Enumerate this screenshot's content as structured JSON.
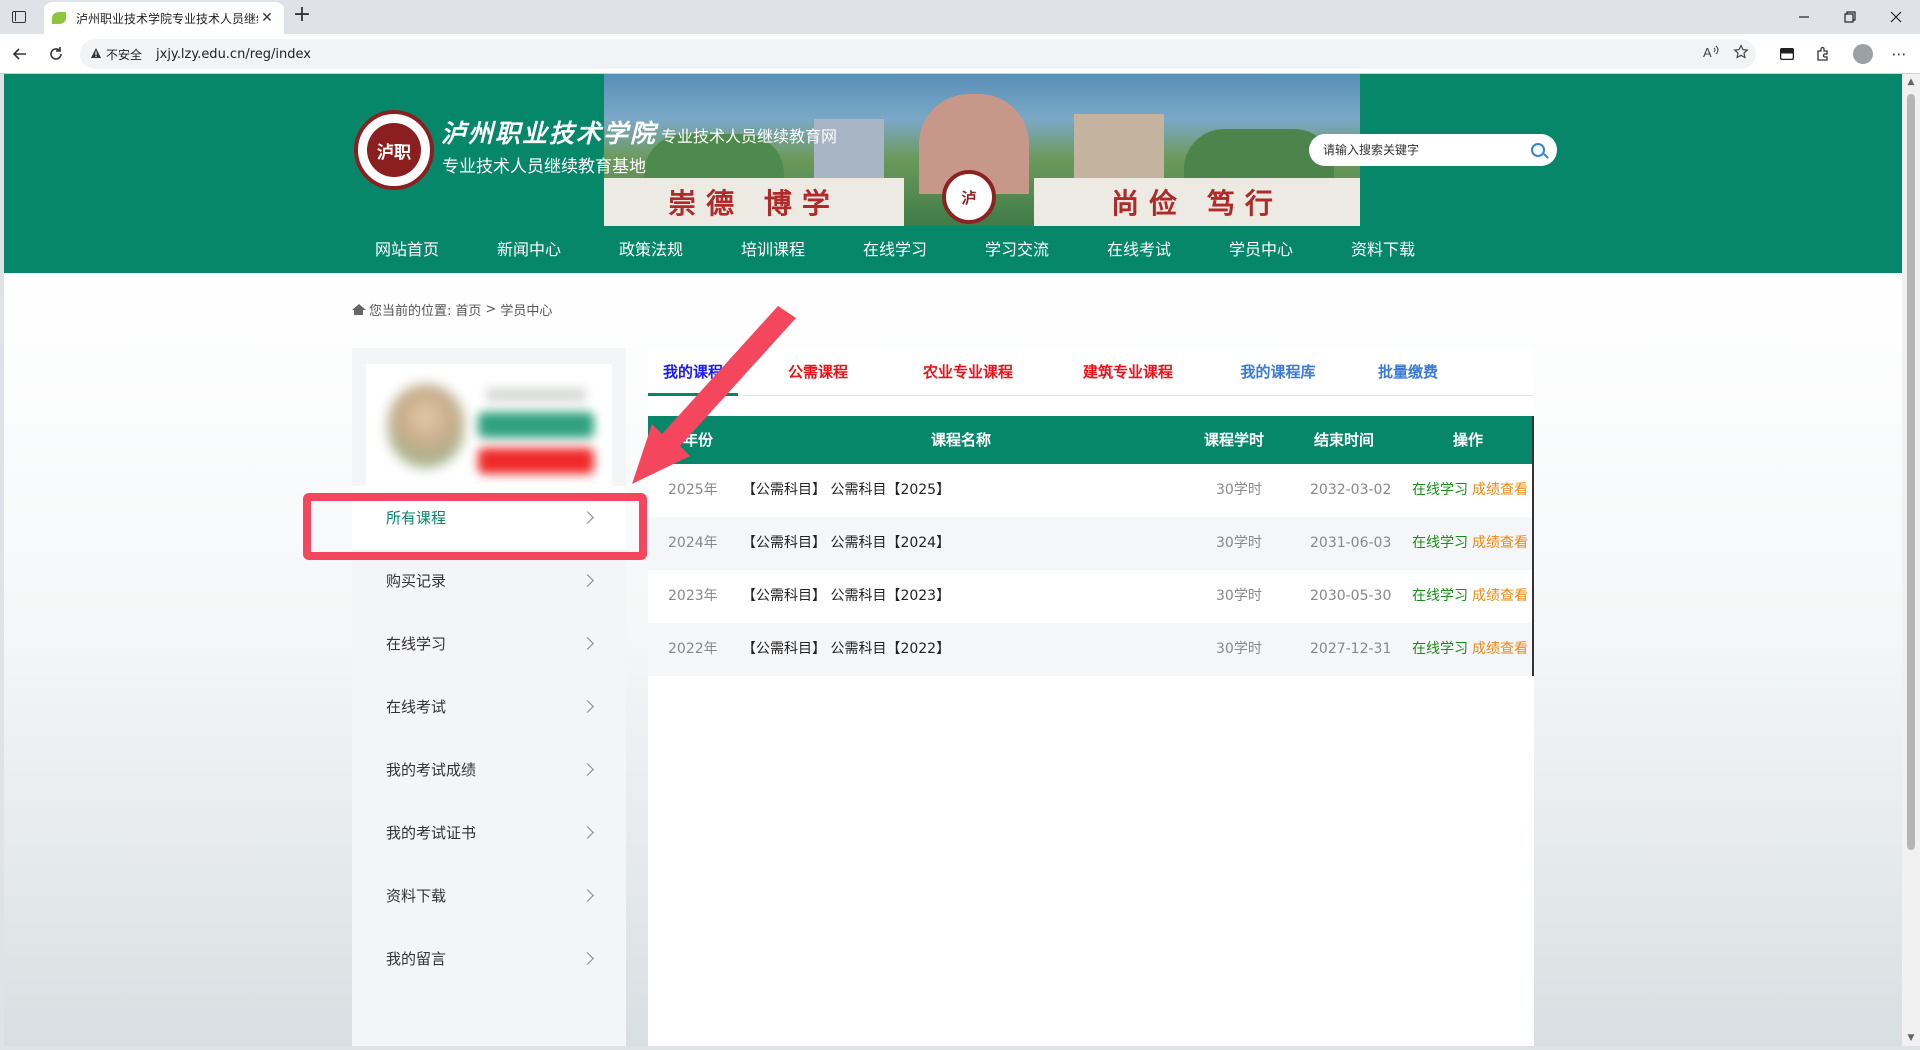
{
  "browser": {
    "tab_title": "泸州职业技术学院专业技术人员继续教育网",
    "close_glyph": "✕",
    "new_tab_glyph": "+",
    "security_label": "不安全",
    "url": "jxjy.lzy.edu.cn/reg/index",
    "more_glyph": "⋯"
  },
  "header": {
    "site_name": "泸州职业技术学院",
    "site_name_suffix": "专业技术人员继续教育网",
    "site_subtitle": "专业技术人员继续教育基地",
    "logo_text": "泸职",
    "motto_left": "崇德  博学",
    "motto_right": "尚俭  笃行",
    "search_placeholder": "请输入搜索关键字",
    "nav": [
      "网站首页",
      "新闻中心",
      "政策法规",
      "培训课程",
      "在线学习",
      "学习交流",
      "在线考试",
      "学员中心",
      "资料下载"
    ]
  },
  "breadcrumb": {
    "prefix": "您当前的位置:",
    "home": "首页",
    "sep": ">",
    "current": "学员中心"
  },
  "sidebar": {
    "items": [
      {
        "label": "所有课程",
        "active": true
      },
      {
        "label": "购买记录"
      },
      {
        "label": "在线学习"
      },
      {
        "label": "在线考试"
      },
      {
        "label": "我的考试成绩"
      },
      {
        "label": "我的考试证书"
      },
      {
        "label": "资料下载"
      },
      {
        "label": "我的留言"
      }
    ]
  },
  "subtabs": [
    {
      "label": "我的课程",
      "color": "#1a1aff",
      "active": true
    },
    {
      "label": "公需课程",
      "color": "#e8141c"
    },
    {
      "label": "农业专业课程",
      "color": "#e8141c"
    },
    {
      "label": "建筑专业课程",
      "color": "#e8141c"
    },
    {
      "label": "我的课程库",
      "color": "#3b7bd6"
    },
    {
      "label": "批量缴费",
      "color": "#3b7bd6"
    }
  ],
  "table": {
    "headers": [
      "年份",
      "课程名称",
      "课程学时",
      "结束时间",
      "操作"
    ],
    "rows": [
      {
        "year": "2025年",
        "name": "【公需科目】 公需科目【2025】",
        "hours": "30学时",
        "end": "2032-03-02",
        "study": "在线学习",
        "grade": "成绩查看"
      },
      {
        "year": "2024年",
        "name": "【公需科目】 公需科目【2024】",
        "hours": "30学时",
        "end": "2031-06-03",
        "study": "在线学习",
        "grade": "成绩查看"
      },
      {
        "year": "2023年",
        "name": "【公需科目】 公需科目【2023】",
        "hours": "30学时",
        "end": "2030-05-30",
        "study": "在线学习",
        "grade": "成绩查看"
      },
      {
        "year": "2022年",
        "name": "【公需科目】 公需科目【2022】",
        "hours": "30学时",
        "end": "2027-12-31",
        "study": "在线学习",
        "grade": "成绩查看"
      }
    ]
  },
  "colors": {
    "brand_green": "#07876a",
    "highlight_red": "#f4475e"
  }
}
